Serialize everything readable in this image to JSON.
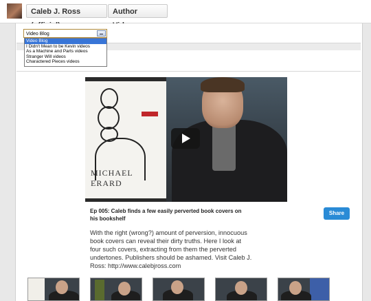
{
  "header": {
    "channel_label": "Caleb J. Ross (official)",
    "section_label": "Author Videos",
    "section_caret": "▼"
  },
  "playlist_select": {
    "value": "Video Blog",
    "options": [
      "Video Blog",
      "I Didn't Mean to be Kevin videos",
      "As a Machine and Parts videos",
      "Stranger Will videos",
      "Charactered Pieces videos"
    ],
    "highlighted_index": 0
  },
  "featured_video": {
    "book_author": "MICHAEL ERARD",
    "title": "Ep 005: Caleb finds a few easily perverted book covers on his bookshelf",
    "description": "With the right (wrong?) amount of perversion, innocuous book covers can reveal their dirty truths. Here I look at four such covers, extracting from them the perverted undertones. Publishers should be ashamed. Visit Caleb J. Ross: http://www.calebjross.com",
    "share_label": "Share"
  },
  "colors": {
    "share_button": "#2a8bd6",
    "selected_option": "#3875d7"
  }
}
